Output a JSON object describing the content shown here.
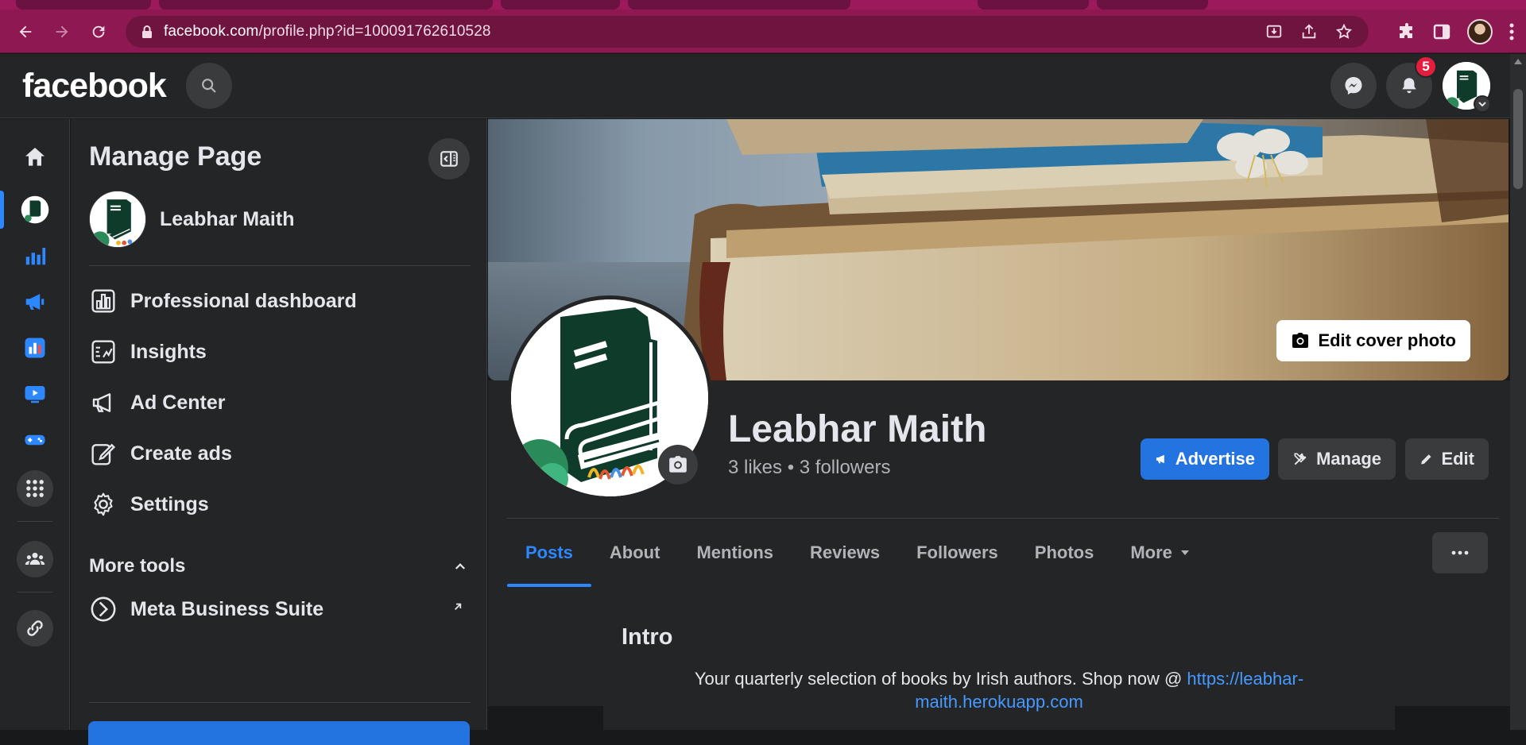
{
  "browser": {
    "url_host": "facebook.com",
    "url_path": "/profile.php?id=100091762610528"
  },
  "header": {
    "logo": "facebook",
    "notifications_count": "5"
  },
  "manage_panel": {
    "title": "Manage Page",
    "page_name": "Leabhar Maith",
    "items": [
      {
        "label": "Professional dashboard",
        "icon": "dashboard-icon"
      },
      {
        "label": "Insights",
        "icon": "insights-icon"
      },
      {
        "label": "Ad Center",
        "icon": "megaphone-icon"
      },
      {
        "label": "Create ads",
        "icon": "pencil-icon"
      },
      {
        "label": "Settings",
        "icon": "gear-icon"
      }
    ],
    "more_tools_label": "More tools",
    "more_tools_items": [
      {
        "label": "Meta Business Suite",
        "icon": "meta-business-icon"
      }
    ]
  },
  "profile": {
    "name": "Leabhar Maith",
    "stats": "3 likes • 3 followers",
    "edit_cover_label": "Edit cover photo",
    "actions": {
      "advertise": "Advertise",
      "manage": "Manage",
      "edit": "Edit"
    },
    "tabs": [
      "Posts",
      "About",
      "Mentions",
      "Reviews",
      "Followers",
      "Photos",
      "More"
    ],
    "active_tab": "Posts"
  },
  "intro": {
    "title": "Intro",
    "text": "Your quarterly selection of books by Irish authors. Shop now @ ",
    "link": "https://leabhar-maith.herokuapp.com",
    "link_line1": "https://leabhar-",
    "link_line2": "maith.herokuapp.com"
  },
  "colors": {
    "browser_accent": "#8e1952",
    "fb_blue": "#2374e1",
    "link_blue": "#4599ff",
    "badge_red": "#e41e3f",
    "page_green": "#0f3b2a"
  }
}
